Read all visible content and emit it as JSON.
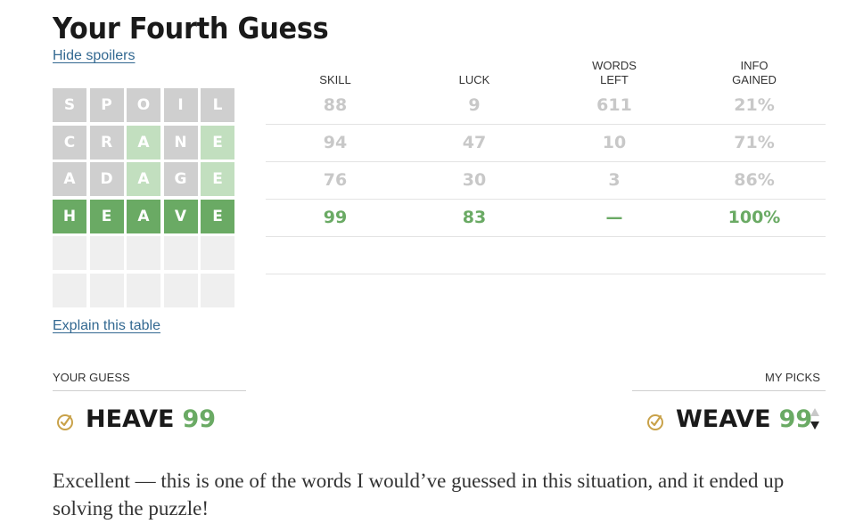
{
  "header": {
    "title": "Your Fourth Guess",
    "hide_spoilers": "Hide spoilers",
    "explain": "Explain this table"
  },
  "board": {
    "rows": [
      {
        "tiles": [
          {
            "letter": "S",
            "state": "gray"
          },
          {
            "letter": "P",
            "state": "gray"
          },
          {
            "letter": "O",
            "state": "gray"
          },
          {
            "letter": "I",
            "state": "gray"
          },
          {
            "letter": "L",
            "state": "gray"
          }
        ]
      },
      {
        "tiles": [
          {
            "letter": "C",
            "state": "gray"
          },
          {
            "letter": "R",
            "state": "gray"
          },
          {
            "letter": "A",
            "state": "lgreen"
          },
          {
            "letter": "N",
            "state": "gray"
          },
          {
            "letter": "E",
            "state": "lgreen"
          }
        ]
      },
      {
        "tiles": [
          {
            "letter": "A",
            "state": "gray"
          },
          {
            "letter": "D",
            "state": "gray"
          },
          {
            "letter": "A",
            "state": "lgreen"
          },
          {
            "letter": "G",
            "state": "gray"
          },
          {
            "letter": "E",
            "state": "lgreen"
          }
        ]
      },
      {
        "tiles": [
          {
            "letter": "H",
            "state": "green"
          },
          {
            "letter": "E",
            "state": "green"
          },
          {
            "letter": "A",
            "state": "green"
          },
          {
            "letter": "V",
            "state": "green"
          },
          {
            "letter": "E",
            "state": "green"
          }
        ]
      },
      {
        "tiles": [
          {
            "letter": "",
            "state": "empty"
          },
          {
            "letter": "",
            "state": "empty"
          },
          {
            "letter": "",
            "state": "empty"
          },
          {
            "letter": "",
            "state": "empty"
          },
          {
            "letter": "",
            "state": "empty"
          }
        ]
      },
      {
        "tiles": [
          {
            "letter": "",
            "state": "empty"
          },
          {
            "letter": "",
            "state": "empty"
          },
          {
            "letter": "",
            "state": "empty"
          },
          {
            "letter": "",
            "state": "empty"
          },
          {
            "letter": "",
            "state": "empty"
          }
        ]
      }
    ]
  },
  "stats": {
    "headers": [
      {
        "line1": "",
        "line2": "SKILL"
      },
      {
        "line1": "",
        "line2": "LUCK"
      },
      {
        "line1": "WORDS",
        "line2": "LEFT"
      },
      {
        "line1": "INFO",
        "line2": "GAINED"
      }
    ],
    "rows": [
      {
        "skill": "88",
        "luck": "9",
        "words_left": "611",
        "info_gained": "21%",
        "active": false
      },
      {
        "skill": "94",
        "luck": "47",
        "words_left": "10",
        "info_gained": "71%",
        "active": false
      },
      {
        "skill": "76",
        "luck": "30",
        "words_left": "3",
        "info_gained": "86%",
        "active": false
      },
      {
        "skill": "99",
        "luck": "83",
        "words_left": "—",
        "info_gained": "100%",
        "active": true
      },
      {
        "skill": "",
        "luck": "",
        "words_left": "",
        "info_gained": "",
        "active": false
      }
    ]
  },
  "comparison": {
    "your_guess_label": "YOUR GUESS",
    "my_picks_label": "MY PICKS",
    "your_guess": {
      "word": "HEAVE",
      "score": "99",
      "icon": "check-circle-icon"
    },
    "my_pick": {
      "word": "WEAVE",
      "score": "99",
      "icon": "check-circle-icon"
    }
  },
  "message": "Excellent — this is one of the words I would’ve guessed in this situation, and it ended up solving the puzzle!",
  "colors": {
    "green": "#6aaa64",
    "light_green": "#c2dfbf",
    "gray_tile": "#cfcfcf",
    "empty_tile": "#efefef",
    "link": "#326891",
    "icon_gold": "#c9a24a"
  }
}
